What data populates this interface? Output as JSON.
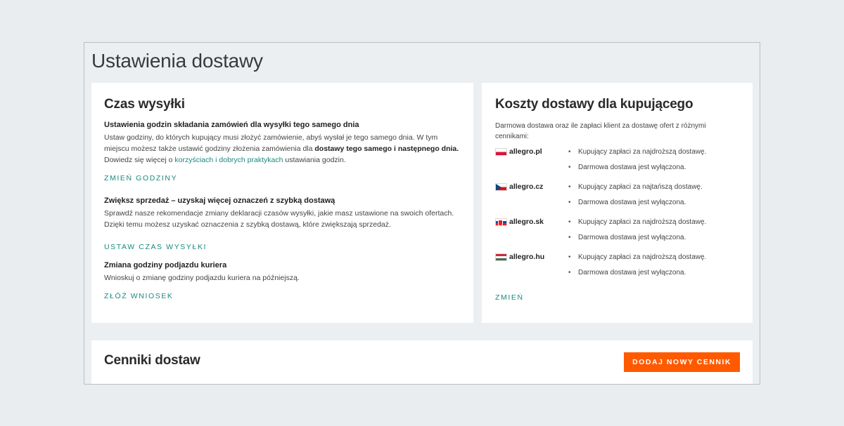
{
  "page": {
    "title": "Ustawienia dostawy"
  },
  "shipping_time": {
    "heading": "Czas wysyłki",
    "sections": [
      {
        "title": "Ustawienia godzin składania zamówień dla wysyłki tego samego dnia",
        "text_parts": [
          "Ustaw godziny, do których kupujący musi złożyć zamówienie, abyś wysłał je tego samego dnia. W tym miejscu możesz także ustawić godziny złożenia zamówienia dla ",
          "dostawy tego samego i następnego dnia.",
          " Dowiedz się więcej o ",
          "korzyściach i dobrych praktykach",
          " ustawiania godzin."
        ],
        "link": "ZMIEŃ GODZINY"
      },
      {
        "title": "Zwiększ sprzedaż – uzyskaj więcej oznaczeń z szybką dostawą",
        "text": "Sprawdź nasze rekomendacje zmiany deklaracji czasów wysyłki, jakie masz ustawione na swoich ofertach. Dzięki temu możesz uzyskać oznaczenia z szybką dostawą, które zwiększają sprzedaż.",
        "link": "USTAW CZAS WYSYŁKI"
      },
      {
        "title": "Zmiana godziny podjazdu kuriera",
        "text": "Wnioskuj o zmianę godziny podjazdu kuriera na późniejszą.",
        "link": "ZŁÓŻ WNIOSEK"
      }
    ]
  },
  "buyer_costs": {
    "heading": "Koszty dostawy dla kupującego",
    "description": "Darmowa dostawa oraz ile zapłaci klient za dostawę ofert z różnymi cennikami:",
    "markets": [
      {
        "name": "allegro.pl",
        "flag": "flag-pl-icon",
        "lines": [
          "Kupujący zapłaci za najdroższą dostawę.",
          "Darmowa dostawa jest wyłączona."
        ]
      },
      {
        "name": "allegro.cz",
        "flag": "flag-cz-icon",
        "lines": [
          "Kupujący zapłaci za najtańszą dostawę.",
          "Darmowa dostawa jest wyłączona."
        ]
      },
      {
        "name": "allegro.sk",
        "flag": "flag-sk-icon",
        "lines": [
          "Kupujący zapłaci za najdroższą dostawę.",
          "Darmowa dostawa jest wyłączona."
        ]
      },
      {
        "name": "allegro.hu",
        "flag": "flag-hu-icon",
        "lines": [
          "Kupujący zapłaci za najdroższą dostawę.",
          "Darmowa dostawa jest wyłączona."
        ]
      }
    ],
    "link": "ZMIEŃ"
  },
  "price_lists": {
    "heading": "Cenniki dostaw",
    "add_button": "DODAJ NOWY CENNIK"
  },
  "colors": {
    "accent_link": "#1a8a7d",
    "primary_button": "#ff5a00",
    "background": "#eaedf0"
  }
}
